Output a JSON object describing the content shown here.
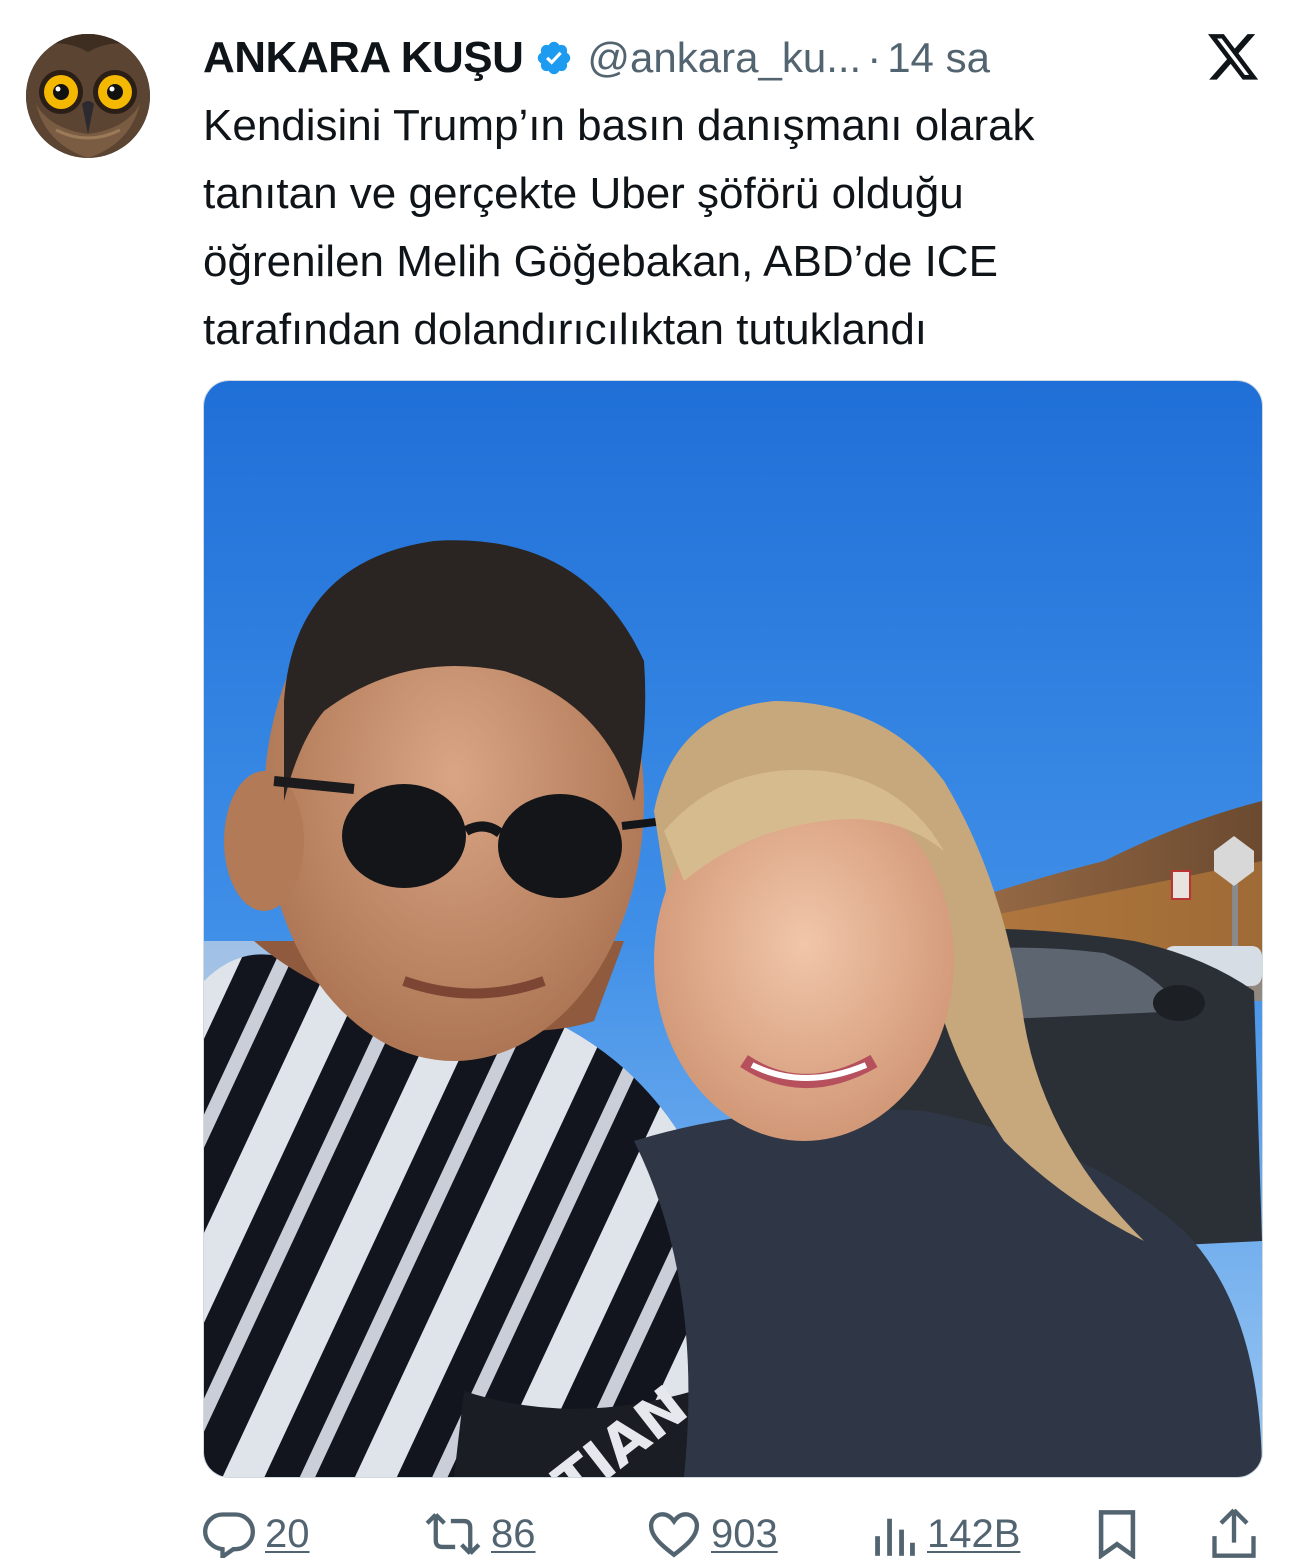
{
  "author": {
    "name": "ANKARA KUŞU",
    "handle": "@ankara_ku...",
    "separator": "·",
    "time": "14 sa",
    "verified": true
  },
  "tweet": {
    "text": "Kendisini Trump’ın basın danışmanı olarak\ntanıtan ve gerçekte Uber şöförü olduğu\nöğrenilen Melih Göğebakan, ABD’de ICE\ntarafından dolandırıcılıktan tutuklandı"
  },
  "media": {
    "shirt_text": "STIAN D"
  },
  "actions": {
    "replies": "20",
    "reposts": "86",
    "likes": "903",
    "views": "142B"
  },
  "icons": {
    "reply": "reply-icon",
    "repost": "repost-icon",
    "like": "heart-icon",
    "views": "views-icon",
    "bookmark": "bookmark-icon",
    "share": "share-icon",
    "brand": "x-logo-icon",
    "verified": "verified-badge-icon"
  },
  "colors": {
    "text": "#0f1419",
    "secondary": "#536471",
    "verified": "#1d9bf0"
  }
}
